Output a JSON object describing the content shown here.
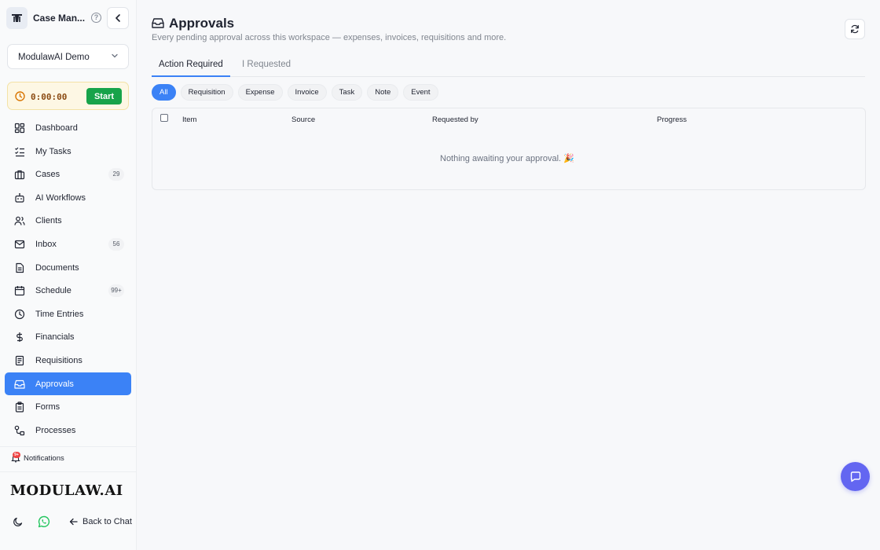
{
  "app": {
    "title": "Case Man...",
    "workspace": "ModulawAI Demo",
    "timer": {
      "value": "0:00:00",
      "start_label": "Start"
    }
  },
  "sidebar": {
    "items": [
      {
        "label": "Dashboard",
        "icon": "dashboard-icon",
        "badge": ""
      },
      {
        "label": "My Tasks",
        "icon": "tasks-icon",
        "badge": ""
      },
      {
        "label": "Cases",
        "icon": "briefcase-icon",
        "badge": "29"
      },
      {
        "label": "AI Workflows",
        "icon": "robot-icon",
        "badge": ""
      },
      {
        "label": "Clients",
        "icon": "users-icon",
        "badge": ""
      },
      {
        "label": "Inbox",
        "icon": "mail-icon",
        "badge": "56"
      },
      {
        "label": "Documents",
        "icon": "document-icon",
        "badge": ""
      },
      {
        "label": "Schedule",
        "icon": "calendar-icon",
        "badge": "99+"
      },
      {
        "label": "Time Entries",
        "icon": "clock-icon",
        "badge": ""
      },
      {
        "label": "Financials",
        "icon": "dollar-icon",
        "badge": ""
      },
      {
        "label": "Requisitions",
        "icon": "requisition-icon",
        "badge": ""
      },
      {
        "label": "Approvals",
        "icon": "inbox-tray-icon",
        "badge": ""
      },
      {
        "label": "Forms",
        "icon": "clipboard-icon",
        "badge": ""
      },
      {
        "label": "Processes",
        "icon": "process-icon",
        "badge": ""
      }
    ],
    "active_index": 11,
    "notifications": {
      "label": "Notifications",
      "badge": "9+"
    },
    "logo_text": "MODULAW.AI",
    "back_label": "Back to Chat"
  },
  "main": {
    "title": "Approvals",
    "subtitle": "Every pending approval across this workspace — expenses, invoices, requisitions and more.",
    "tabs": [
      "Action Required",
      "I Requested"
    ],
    "active_tab": 0,
    "filters": [
      "All",
      "Requisition",
      "Expense",
      "Invoice",
      "Task",
      "Note",
      "Event"
    ],
    "active_filter": 0,
    "table": {
      "columns": [
        "Item",
        "Source",
        "Requested by",
        "Progress"
      ],
      "empty_message": "Nothing awaiting your approval. 🎉"
    }
  },
  "colors": {
    "accent": "#3b82f6",
    "start": "#17a34a",
    "fab": "#6366f1",
    "timer_bg": "#fdf7e4"
  }
}
